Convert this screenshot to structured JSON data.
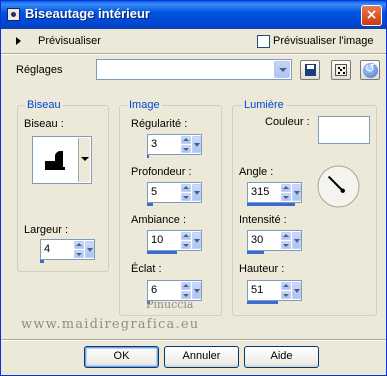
{
  "window": {
    "title": "Biseautage intérieur",
    "close_label": "×"
  },
  "preview": {
    "label": "Prévisualiser",
    "checkbox_label": "Prévisualiser l'image",
    "checked": false
  },
  "settings": {
    "label": "Réglages",
    "value": ""
  },
  "bevel_group": {
    "title": "Biseau",
    "bevel_label": "Biseau :",
    "width_label": "Largeur :",
    "width_value": "4",
    "width_fill": 0.08
  },
  "image_group": {
    "title": "Image",
    "fields": [
      {
        "label": "Régularité :",
        "value": "3",
        "fill": 0.03
      },
      {
        "label": "Profondeur :",
        "value": "5",
        "fill": 0.1
      },
      {
        "label": "Ambiance :",
        "value": "10",
        "fill": 0.55
      },
      {
        "label": "Éclat :",
        "value": "6",
        "fill": 0.06
      }
    ]
  },
  "light_group": {
    "title": "Lumière",
    "color_label": "Couleur :",
    "color_value": "#ffffff",
    "angle_label": "Angle :",
    "angle_value": "315",
    "angle_fill": 0.875,
    "intensity_label": "Intensité :",
    "intensity_value": "30",
    "intensity_fill": 0.3,
    "height_label": "Hauteur :",
    "height_value": "51",
    "height_fill": 0.57
  },
  "watermark": {
    "line1": "Pinuccia",
    "line2": "www.maidiregrafica.eu"
  },
  "buttons": {
    "ok": "OK",
    "cancel": "Annuler",
    "help": "Aide"
  },
  "colors": {
    "title_blue": "#0054e3",
    "group_title": "#0046d5",
    "slider_fill": "#3a6ad4",
    "face": "#ece9d8"
  }
}
